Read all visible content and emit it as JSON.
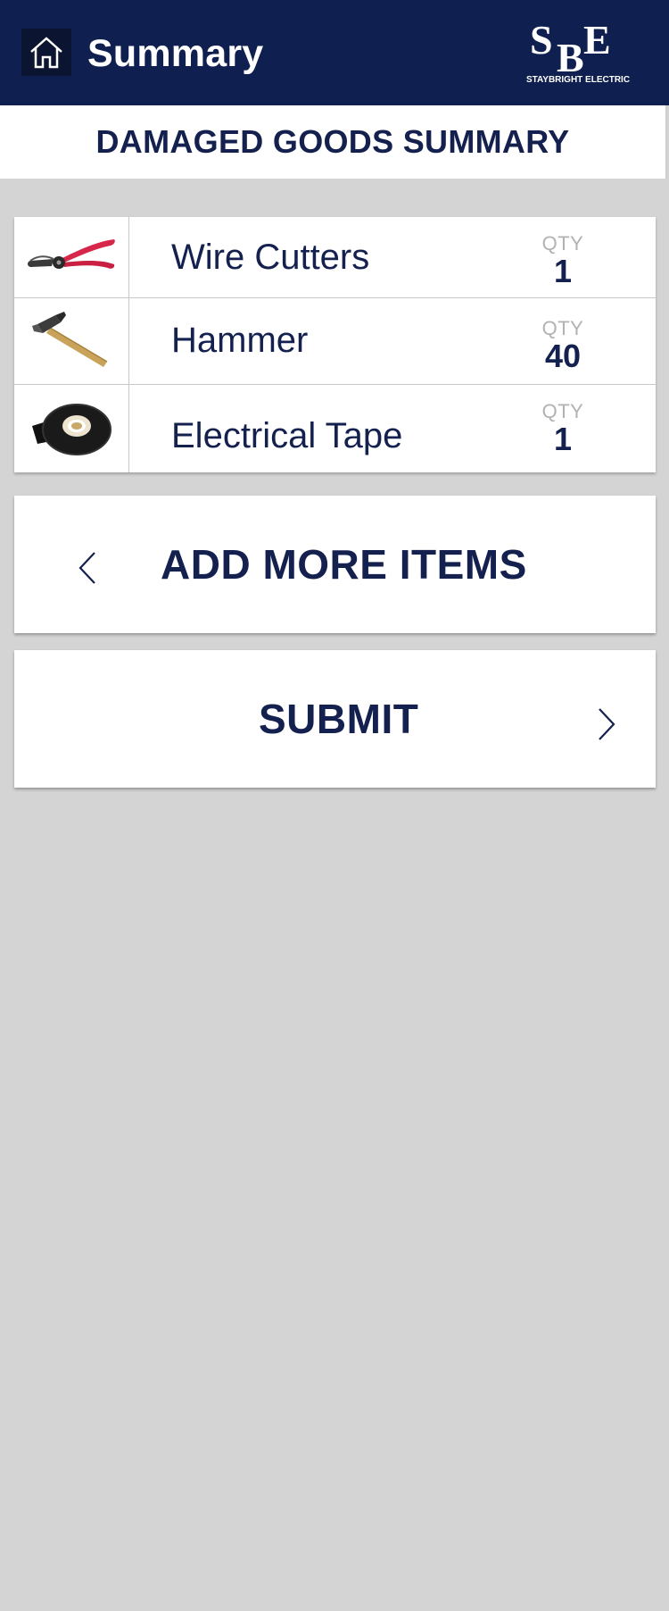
{
  "header": {
    "title": "Summary",
    "home_icon": "home-icon",
    "logo": {
      "letters": "SBE",
      "caption": "STAYBRIGHT ELECTRIC"
    }
  },
  "subheader": {
    "title": "DAMAGED GOODS SUMMARY"
  },
  "items": [
    {
      "name": "Wire Cutters",
      "qty_label": "QTY",
      "qty": "1",
      "icon": "wire-cutters-image"
    },
    {
      "name": "Hammer",
      "qty_label": "QTY",
      "qty": "40",
      "icon": "hammer-image"
    },
    {
      "name": "Electrical Tape",
      "qty_label": "QTY",
      "qty": "1",
      "icon": "electrical-tape-image"
    }
  ],
  "actions": {
    "add_more_label": "ADD MORE ITEMS",
    "add_more_icon": "chevron-left-icon",
    "submit_label": "SUBMIT",
    "submit_icon": "chevron-right-icon"
  },
  "colors": {
    "navy": "#0f1f4f",
    "text_navy": "#14214f",
    "background": "#d4d4d4",
    "qty_label": "#b2b2b2"
  }
}
